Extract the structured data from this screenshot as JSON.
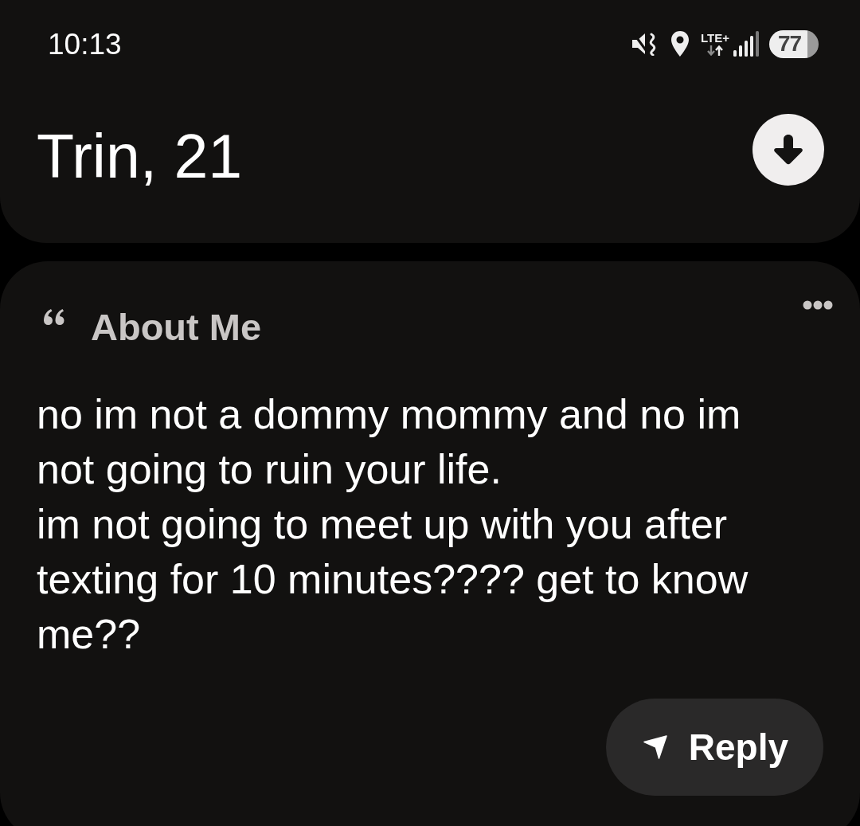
{
  "status_bar": {
    "time": "10:13",
    "network": "LTE+",
    "battery": "77"
  },
  "header": {
    "title": "Trin, 21"
  },
  "about": {
    "title": "About Me",
    "text": "no im not a dommy mommy and no im not going to ruin your life.\nim not going to meet up with you after texting for 10 minutes???? get to know me??"
  },
  "reply_button": {
    "label": "Reply"
  }
}
